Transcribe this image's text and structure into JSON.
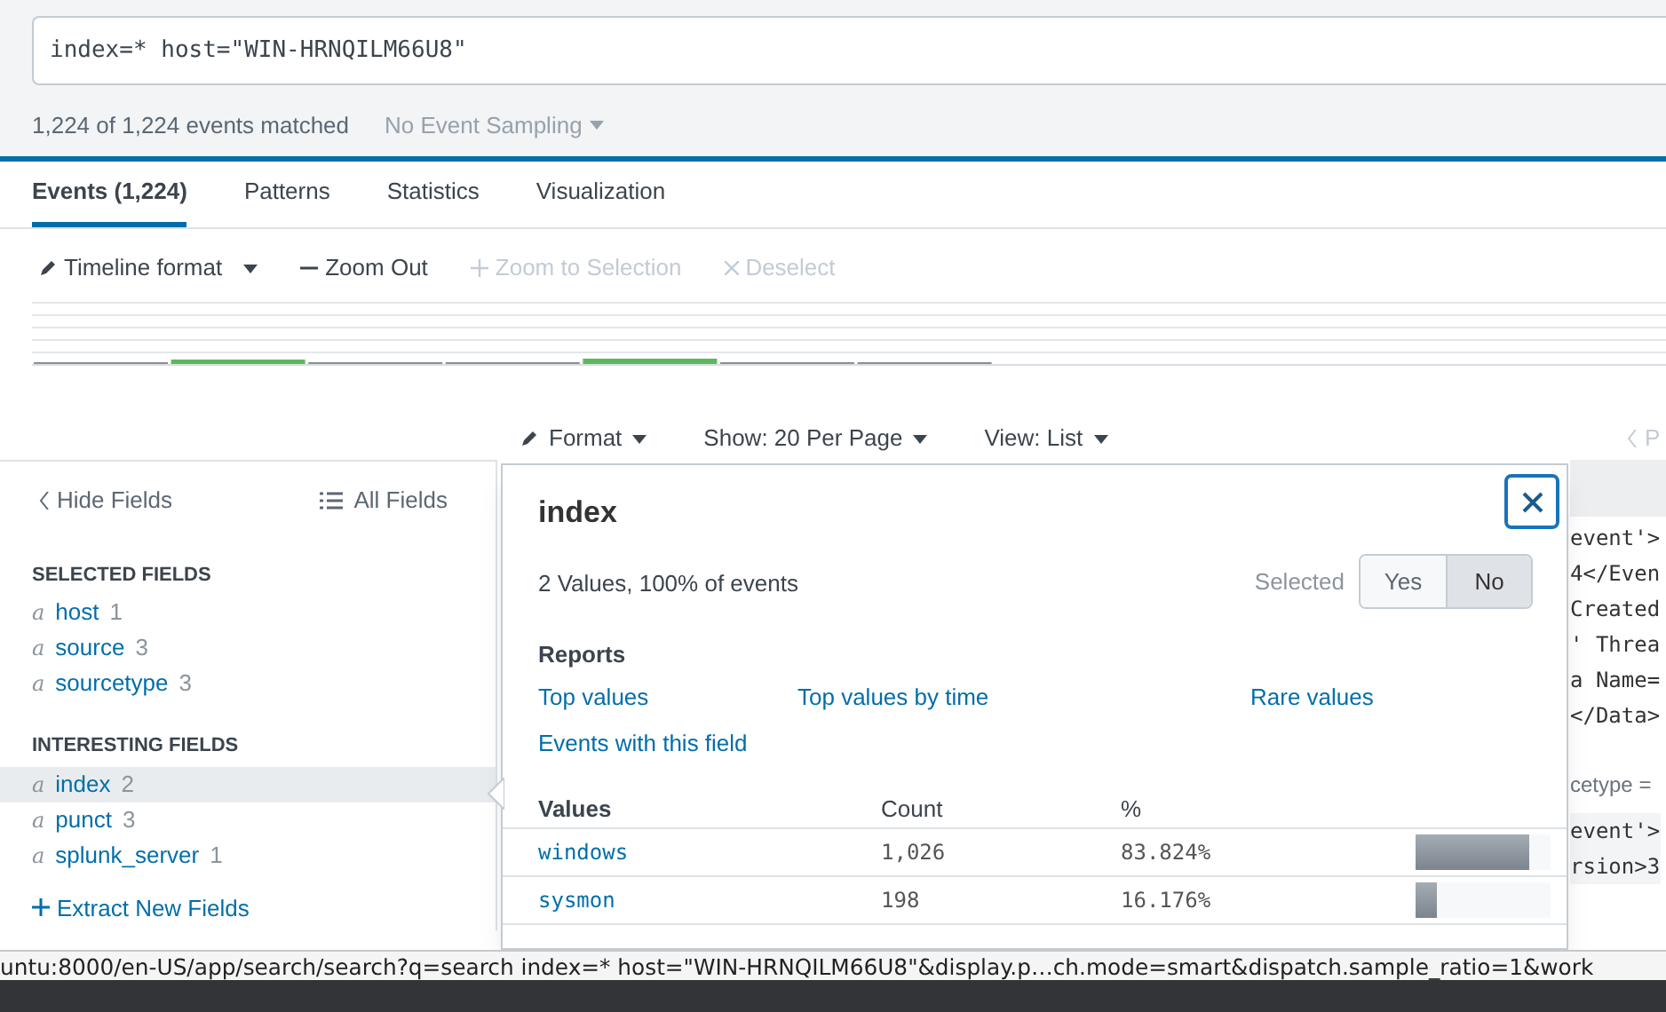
{
  "search": {
    "value": "index=* host=\"WIN-HRNQILM66U8\""
  },
  "match_summary": "1,224 of 1,224 events matched",
  "sampling": {
    "label": "No Event Sampling",
    "disabled": true
  },
  "tabs": [
    {
      "label": "Events (1,224)",
      "selected": true
    },
    {
      "label": "Patterns",
      "selected": false
    },
    {
      "label": "Statistics",
      "selected": false
    },
    {
      "label": "Visualization",
      "selected": false
    }
  ],
  "timeline_toolbar": [
    {
      "kind": "format",
      "label": "Timeline format",
      "disabled": false
    },
    {
      "kind": "minus",
      "label": "Zoom Out",
      "disabled": false
    },
    {
      "kind": "plus",
      "label": "Zoom to Selection",
      "disabled": true
    },
    {
      "kind": "x",
      "label": "Deselect",
      "disabled": true
    }
  ],
  "results_toolbar": [
    {
      "kind": "format",
      "label": "Format"
    },
    {
      "kind": "menu",
      "label": "Show: 20 Per Page"
    },
    {
      "kind": "menu",
      "label": "View: List"
    }
  ],
  "pager": {
    "label": "P"
  },
  "sidebar": {
    "hide_label": "Hide Fields",
    "all_label": "All Fields",
    "sections": [
      {
        "title": "SELECTED FIELDS",
        "fields": [
          {
            "type": "a",
            "name": "host",
            "count": "1",
            "selected": false
          },
          {
            "type": "a",
            "name": "source",
            "count": "3",
            "selected": false
          },
          {
            "type": "a",
            "name": "sourcetype",
            "count": "3",
            "selected": false
          }
        ]
      },
      {
        "title": "INTERESTING FIELDS",
        "fields": [
          {
            "type": "a",
            "name": "index",
            "count": "2",
            "selected": true
          },
          {
            "type": "a",
            "name": "punct",
            "count": "3",
            "selected": false
          },
          {
            "type": "a",
            "name": "splunk_server",
            "count": "1",
            "selected": false
          }
        ]
      }
    ],
    "extract_label": "Extract New Fields"
  },
  "popup": {
    "title": "index",
    "summary": "2 Values, 100% of events",
    "selected_label": "Selected",
    "toggle": [
      {
        "label": "Yes",
        "selected": false
      },
      {
        "label": "No",
        "selected": true
      }
    ],
    "reports_title": "Reports",
    "reports": [
      "Top values",
      "Top values by time",
      "Rare values",
      "Events with this field"
    ],
    "columns": [
      "Values",
      "Count",
      "%"
    ],
    "rows": [
      {
        "value": "windows",
        "count": "1,026",
        "percent": "83.824%",
        "level": 0.838
      },
      {
        "value": "sysmon",
        "count": "198",
        "percent": "16.176%",
        "level": 0.162
      }
    ]
  },
  "event_fragments": [
    {
      "kind": "code",
      "text": "event'>"
    },
    {
      "kind": "code",
      "text": "4</Even"
    },
    {
      "kind": "code",
      "text": "Created"
    },
    {
      "kind": "code",
      "text": "' Threa"
    },
    {
      "kind": "code",
      "text": "a Name="
    },
    {
      "kind": "code",
      "text": "</Data>"
    },
    {
      "kind": "meta",
      "text": "cetype ="
    },
    {
      "kind": "code2",
      "text": "event'>"
    },
    {
      "kind": "code2",
      "text": "rsion>3"
    }
  ],
  "status_url": "untu:8000/en-US/app/search/search?q=search index=* host=\"WIN-HRNQILM66U8\"&display.p…ch.mode=smart&dispatch.sample_ratio=1&work"
}
